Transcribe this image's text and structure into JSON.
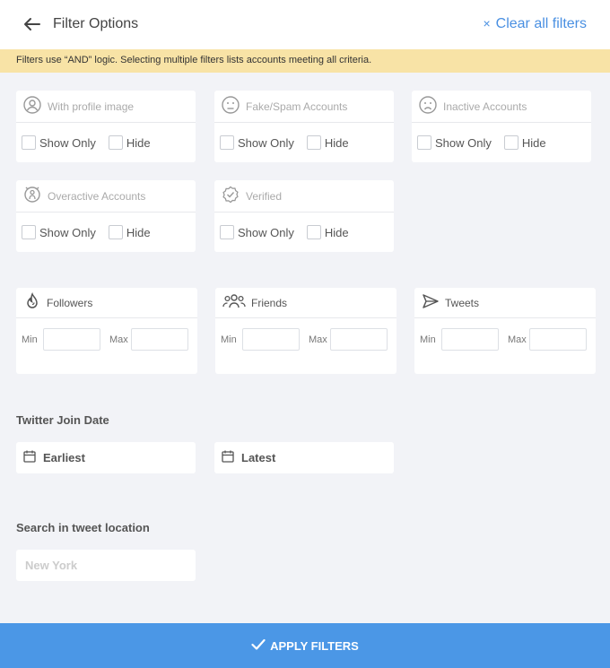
{
  "header": {
    "title": "Filter Options",
    "clear_label": "Clear all filters",
    "clear_icon": "×"
  },
  "notice": "Filters use “AND” logic. Selecting multiple filters lists accounts meeting all criteria.",
  "filters": [
    {
      "label": "With profile image",
      "icon": "user-circle-icon",
      "show": "Show Only",
      "hide": "Hide"
    },
    {
      "label": "Fake/Spam Accounts",
      "icon": "frown-face-icon",
      "show": "Show Only",
      "hide": "Hide"
    },
    {
      "label": "Inactive Accounts",
      "icon": "sad-face-icon",
      "show": "Show Only",
      "hide": "Hide"
    },
    {
      "label": "Overactive Accounts",
      "icon": "activity-person-icon",
      "show": "Show Only",
      "hide": "Hide"
    },
    {
      "label": "Verified",
      "icon": "verified-badge-icon",
      "show": "Show Only",
      "hide": "Hide"
    }
  ],
  "ranges": [
    {
      "label": "Followers",
      "icon": "flame-icon",
      "min": "Min",
      "max": "Max"
    },
    {
      "label": "Friends",
      "icon": "people-group-icon",
      "min": "Min",
      "max": "Max"
    },
    {
      "label": "Tweets",
      "icon": "send-icon",
      "min": "Min",
      "max": "Max"
    }
  ],
  "join_date": {
    "title": "Twitter Join Date",
    "earliest": "Earliest",
    "latest": "Latest"
  },
  "location": {
    "title": "Search in tweet location",
    "placeholder": "New York",
    "value": ""
  },
  "apply_label": "APPLY FILTERS",
  "colors": {
    "accent": "#4b97e6",
    "notice_bg": "#f8e3a6",
    "page_bg": "#f2f3f7"
  }
}
